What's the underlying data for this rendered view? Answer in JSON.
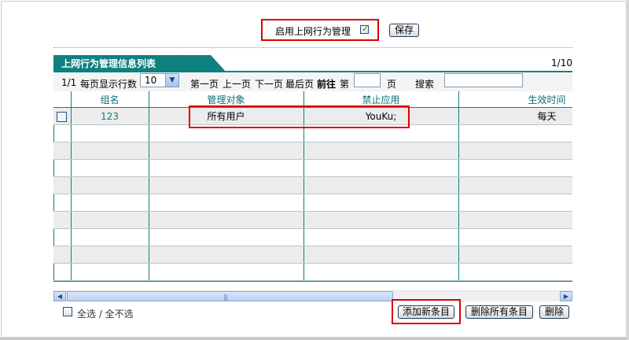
{
  "header": {
    "enable_label": "启用上网行为管理",
    "enable_checked": true,
    "save_label": "保存"
  },
  "list": {
    "title": "上网行为管理信息列表",
    "page_total": "1/10"
  },
  "pager": {
    "current": "1/1",
    "rows_per_page_label": "每页显示行数",
    "rows_per_page_value": "10",
    "first": "第一页",
    "prev": "上一页",
    "next": "下一页",
    "last": "最后页",
    "goto": "前往",
    "page_prefix": "第",
    "page_suffix": "页",
    "search_label": "搜索"
  },
  "table": {
    "columns": [
      "组名",
      "管理对象",
      "禁止应用",
      "生效时间"
    ],
    "rows": [
      {
        "group": "123",
        "target": "所有用户",
        "blocked": "YouKu;",
        "time": "每天"
      }
    ]
  },
  "footer": {
    "select_all_label": "全选 / 全不选",
    "add_label": "添加新条目",
    "delete_all_label": "删除所有条目",
    "delete_label": "删除"
  },
  "colors": {
    "accent": "#0f8080",
    "highlight": "#e00000",
    "row_alt": "#ececec"
  }
}
